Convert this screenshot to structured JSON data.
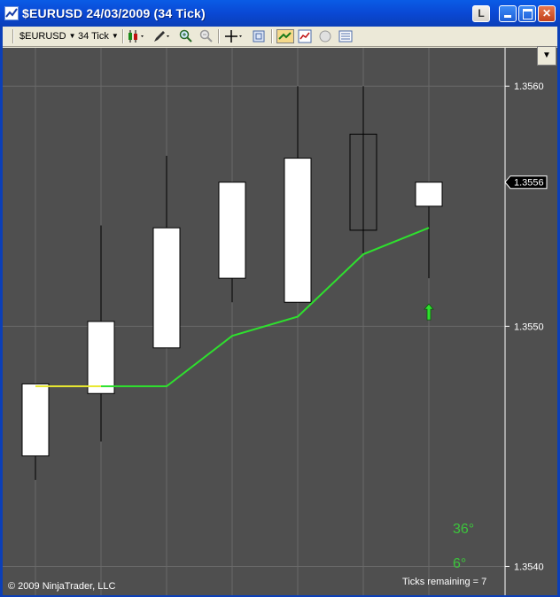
{
  "window": {
    "title": "$EURUSD  24/03/2009 (34 Tick)",
    "link_button": "L",
    "min_icon": "minimize-icon",
    "max_icon": "maximize-icon",
    "close_icon": "close-icon"
  },
  "toolbar": {
    "instrument": "$EURUSD",
    "interval": "34 Tick",
    "icons": [
      "candlestick-icon",
      "pencil-icon",
      "zoom-in-icon",
      "zoom-out-icon",
      "crosshair-icon",
      "properties-icon",
      "strategy-icon",
      "indicators-icon",
      "data-box-icon",
      "chart-trader-icon"
    ]
  },
  "footer": {
    "copyright": "© 2009 NinjaTrader, LLC",
    "ticks_remaining": "Ticks remaining = 7",
    "angle_1": "36°",
    "angle_2": "6°"
  },
  "colors": {
    "background": "#4f4f4f",
    "grid": "#6a6a6a",
    "up_candle": "#ffffff",
    "wick": "#000000",
    "indicator_line": "#2ee02e",
    "indicator_highlight": "#e8e830",
    "signal_arrow": "#2ee02e"
  },
  "chart_data": {
    "type": "candlestick",
    "title": "",
    "xlabel": "",
    "ylabel": "",
    "ylim": [
      1.35388,
      1.35613
    ],
    "yticks": [
      1.354,
      1.355,
      1.356
    ],
    "ytick_labels": [
      "1.3540",
      "1.3550",
      "1.3560"
    ],
    "last_price_label": "1.3556",
    "last_price": 1.3556,
    "grid": true,
    "candles": [
      {
        "open": 1.35446,
        "close": 1.35476,
        "high": 1.35476,
        "low": 1.35436
      },
      {
        "open": 1.35472,
        "close": 1.35502,
        "high": 1.35542,
        "low": 1.35452
      },
      {
        "open": 1.35491,
        "close": 1.35541,
        "high": 1.35571,
        "low": 1.35491
      },
      {
        "open": 1.3552,
        "close": 1.3556,
        "high": 1.3556,
        "low": 1.3551
      },
      {
        "open": 1.3551,
        "close": 1.3557,
        "high": 1.356,
        "low": 1.3551
      },
      {
        "open": 1.3558,
        "close": 1.3554,
        "high": 1.356,
        "low": 1.3553
      },
      {
        "open": 1.3555,
        "close": 1.3556,
        "high": 1.3556,
        "low": 1.3552
      }
    ],
    "indicator": {
      "values": [
        1.35475,
        1.35475,
        1.35496,
        1.35504,
        1.3553,
        1.35541
      ],
      "start_segment": {
        "from": 1.35475,
        "to": 1.35475
      }
    },
    "signal": {
      "type": "up-arrow",
      "candle_index": 6,
      "price": 1.35506
    }
  }
}
